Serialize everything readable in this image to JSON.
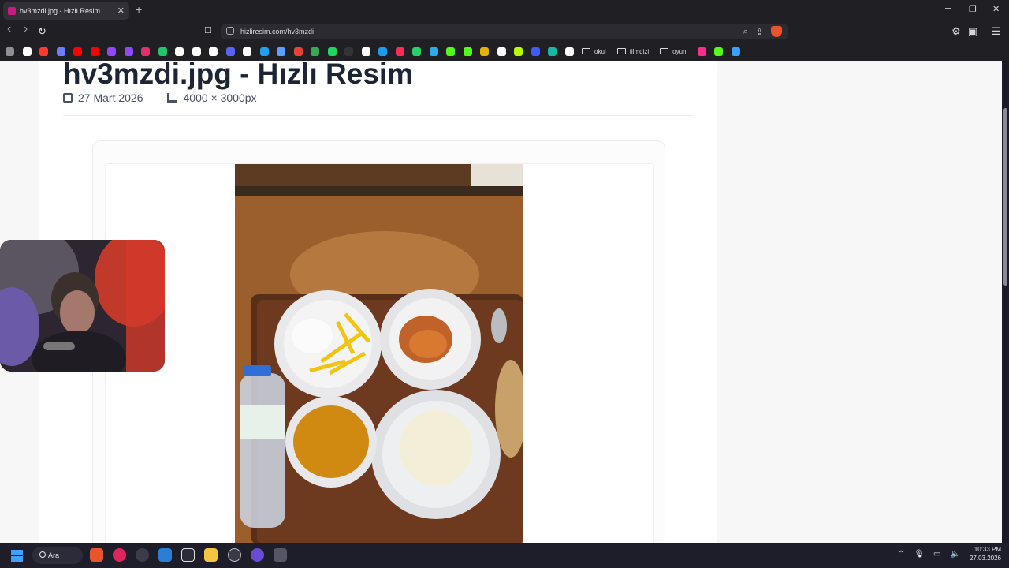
{
  "tab": {
    "title": "hv3mzdi.jpg - Hızlı Resim",
    "close": "✕"
  },
  "newtab": "+",
  "window_controls": {
    "minimize": "─",
    "restore": "❐",
    "close": "✕"
  },
  "nav": {
    "back": "‹",
    "forward": "›",
    "reload": "↻",
    "bookmark": "☐"
  },
  "address": {
    "url": "hizliresim.com/hv3mzdi"
  },
  "bookmarks": {
    "icon_colors": [
      "#8f8f95",
      "#ffffff",
      "#ff3b30",
      "#6c7cff",
      "#ff0000",
      "#ff0000",
      "#9146ff",
      "#9146ff",
      "#e1306c",
      "#22c36e",
      "#ffffff",
      "#ffffff",
      "#ffffff",
      "#5865f2",
      "#ffffff",
      "#1da1f2",
      "#5aa0ff",
      "#ea4335",
      "#34a853",
      "#1ed760",
      "#333333",
      "#ffffff",
      "#1a9cf0",
      "#ff2d55",
      "#25d366",
      "#2aabee",
      "#53fc18",
      "#53fc18",
      "#e4b200",
      "#ffffff",
      "#b6ff00",
      "#3d5afe",
      "#14b8a6",
      "#ffffff"
    ],
    "folders": [
      "okul",
      "filmdizi",
      "oyun"
    ],
    "trailing_colors": [
      "#ff2b8a",
      "#53fc18",
      "#3aa0ff"
    ]
  },
  "page": {
    "title": "hv3mzdi.jpg - Hızlı Resim",
    "date": "27 Mart 2026",
    "dimensions": "4000 × 3000px"
  },
  "taskbar": {
    "search_label": "Ara",
    "apps": [
      "brave",
      "media-player",
      "camera",
      "photos",
      "vpn",
      "file-explorer",
      "chrome-like",
      "synapse",
      "game"
    ],
    "time": "10:33 PM",
    "date": "27.03.2026"
  }
}
